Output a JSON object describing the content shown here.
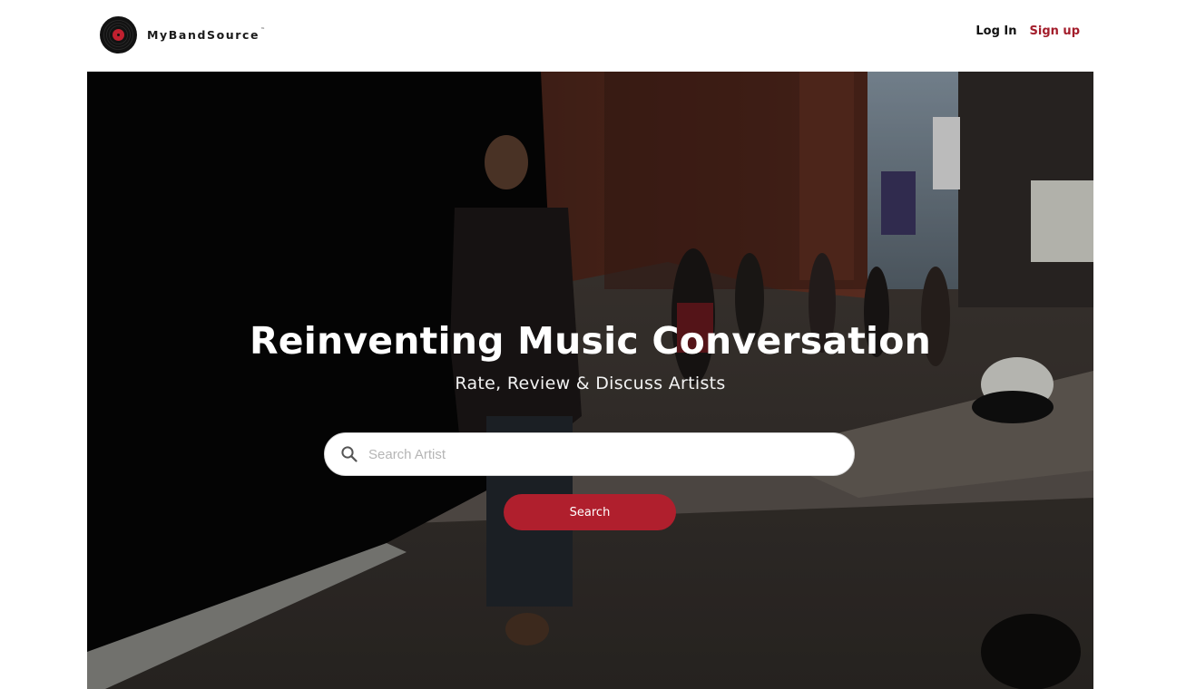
{
  "brand": {
    "name": "MyBandSource",
    "trademark": "™",
    "icon": "vinyl-record-icon",
    "accent_color": "#a31d2b"
  },
  "nav": {
    "login_label": "Log In",
    "signup_label": "Sign up"
  },
  "hero": {
    "background": "street-photo-man-with-earphones",
    "headline": "Reinventing Music Conversation",
    "subheadline": "Rate, Review & Discuss Artists"
  },
  "search": {
    "icon": "search-icon",
    "placeholder": "Search Artist",
    "value": "",
    "button_label": "Search",
    "button_color": "#b01f2d"
  }
}
